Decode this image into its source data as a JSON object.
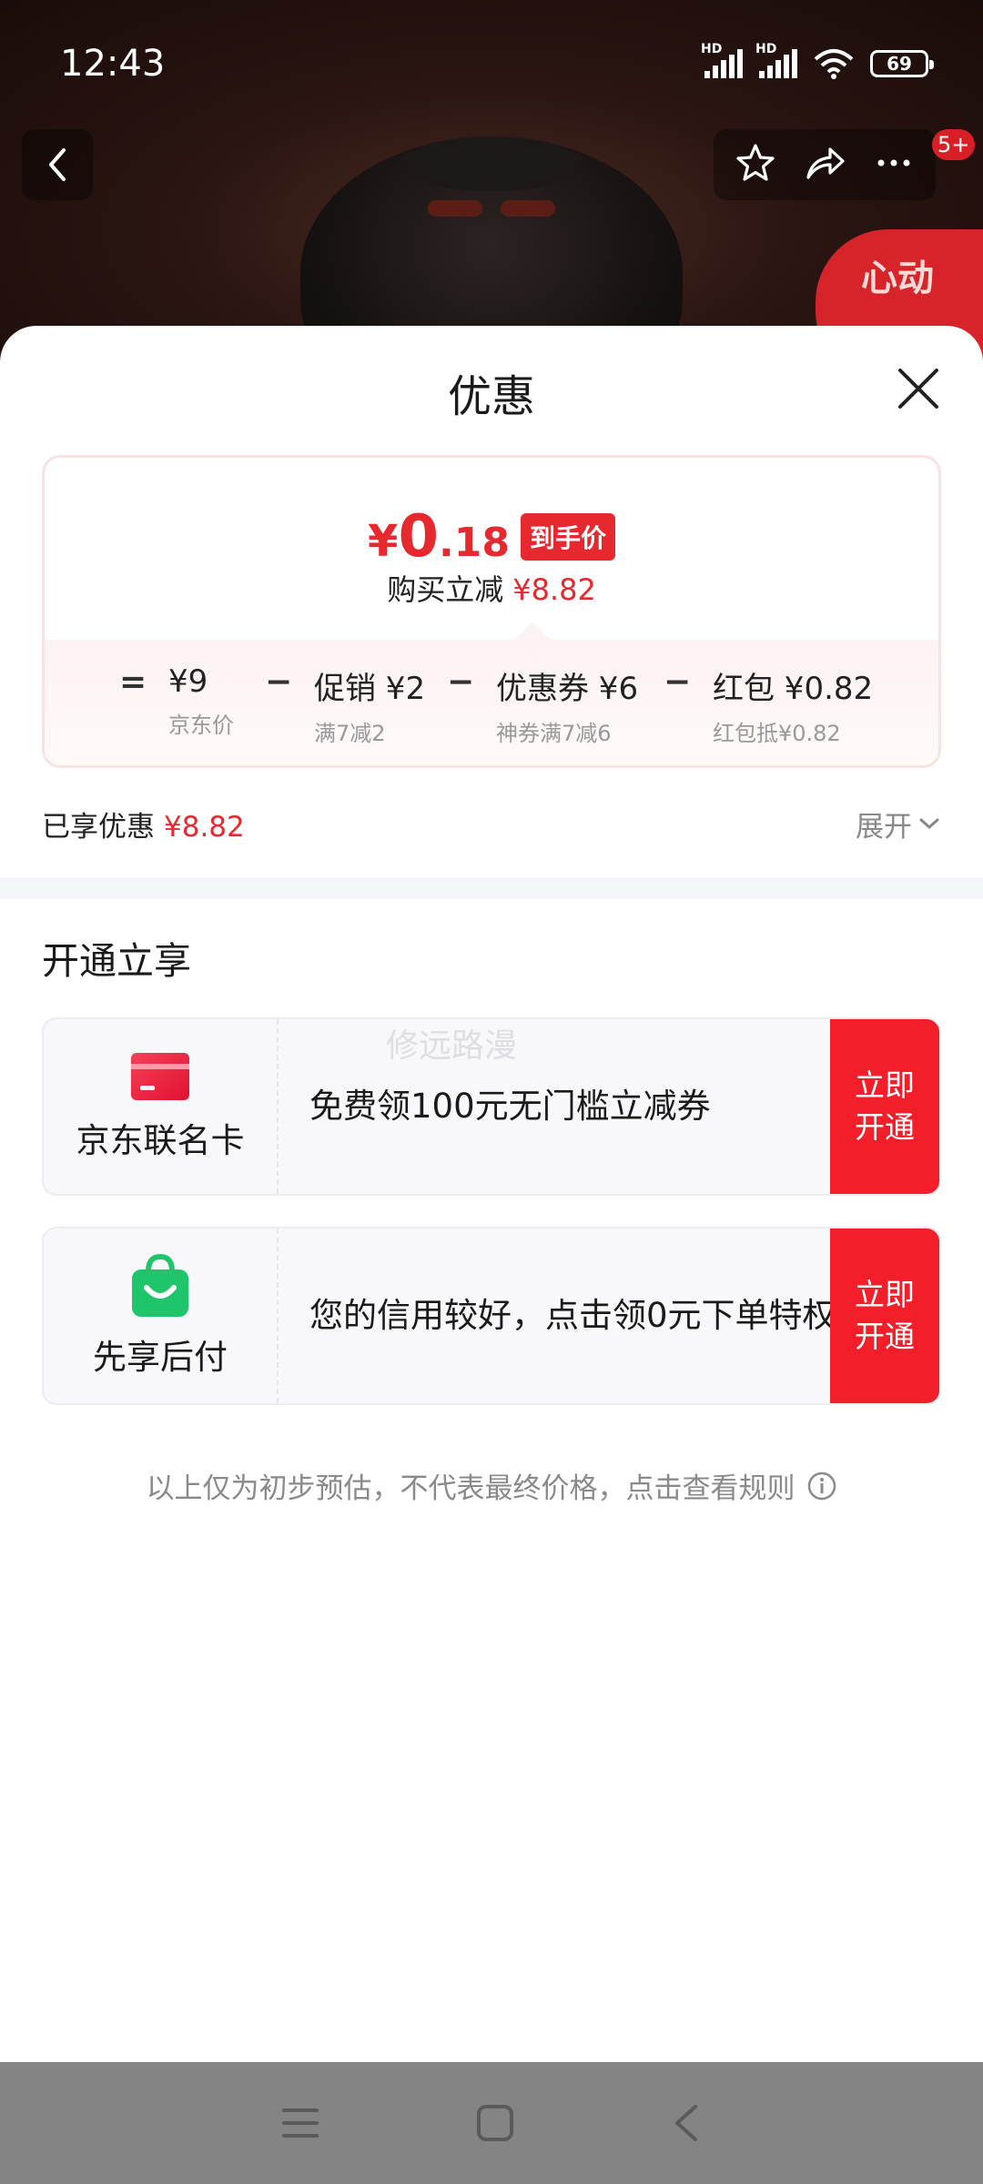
{
  "status_bar": {
    "time": "12:43",
    "network_labels": [
      "HD",
      "HD"
    ],
    "battery": "69"
  },
  "nav": {
    "badge": "5+",
    "promo_bubble_text": "心动"
  },
  "sheet": {
    "title": "优惠",
    "price_card": {
      "final_currency": "¥",
      "final_integer": "0",
      "final_decimal": ".18",
      "final_tag": "到手价",
      "instant_discount_label": "购买立减",
      "instant_discount_value": "¥8.82",
      "breakdown": [
        {
          "op": "=",
          "main": "¥9",
          "sub": "京东价"
        },
        {
          "op": "−",
          "main": "促销 ¥2",
          "sub": "满7减2"
        },
        {
          "op": "−",
          "main": "优惠券 ¥6",
          "sub": "神券满7减6"
        },
        {
          "op": "−",
          "main": "红包 ¥0.82",
          "sub": "红包抵¥0.82"
        }
      ]
    },
    "enjoyed": {
      "label": "已享优惠",
      "value": "¥8.82",
      "expand_label": "展开"
    },
    "open_section": {
      "title": "开通立享",
      "watermark": "修远路漫",
      "offers": [
        {
          "name": "京东联名卡",
          "icon": "credit-card-icon",
          "description": "免费领100元无门槛立减券",
          "button": "立即\n开通"
        },
        {
          "name": "先享后付",
          "icon": "shopping-bag-icon",
          "description": "您的信用较好，点击领0元下单特权",
          "button": "立即\n开通"
        }
      ]
    },
    "disclaimer": "以上仅为初步预估，不代表最终价格，点击查看规则"
  },
  "colors": {
    "accent_red": "#e5292f",
    "button_red": "#f21f2a",
    "card_pink_border": "#fae1e3",
    "wechat_green": "#1fc56a"
  }
}
